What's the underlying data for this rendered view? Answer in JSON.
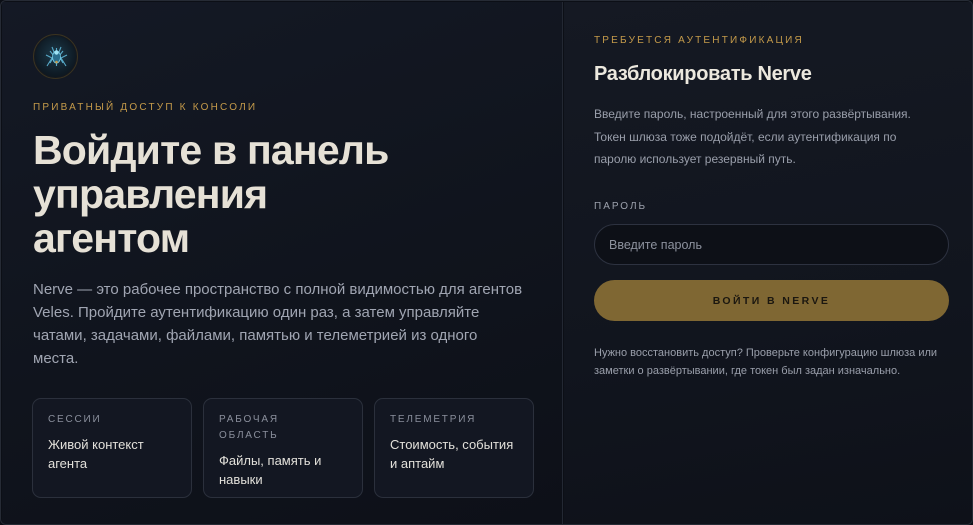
{
  "brand": {
    "logo_icon": "crystal-spider-emblem-icon",
    "accent_color": "#c49a4a",
    "button_color": "#7f6733"
  },
  "hero": {
    "eyebrow": "ПРИВАТНЫЙ ДОСТУП К КОНСОЛИ",
    "title_lines": [
      "Войдите в панель",
      "управления",
      "агентом"
    ],
    "description_lines": [
      "Nerve — это рабочее пространство с полной видимостью для агентов",
      "Veles. Пройдите аутентификацию один раз, а затем управляйте",
      "чатами, задачами, файлами, памятью и телеметрией из одного",
      "места."
    ]
  },
  "feature_cards": [
    {
      "label_lines": [
        "СЕССИИ"
      ],
      "value_lines": [
        "Живой контекст",
        "агента"
      ]
    },
    {
      "label_lines": [
        "РАБОЧАЯ",
        "ОБЛАСТЬ"
      ],
      "value_lines": [
        "Файлы, память и",
        "навыки"
      ]
    },
    {
      "label_lines": [
        "ТЕЛЕМЕТРИЯ"
      ],
      "value_lines": [
        "Стоимость, события",
        "и аптайм"
      ]
    }
  ],
  "auth": {
    "eyebrow": "ТРЕБУЕТСЯ АУТЕНТИФИКАЦИЯ",
    "title": "Разблокировать Nerve",
    "description_lines": [
      "Введите пароль, настроенный для этого развёртывания.",
      "Токен шлюза тоже подойдёт, если аутентификация по",
      "паролю использует резервный путь."
    ],
    "password_label": "ПАРОЛЬ",
    "password_placeholder": "Введите пароль",
    "password_value": "",
    "submit_label": "ВОЙТИ В NERVE",
    "help_lines": [
      "Нужно восстановить доступ? Проверьте конфигурацию шлюза или",
      "заметки о развёртывании, где токен был задан изначально."
    ]
  }
}
